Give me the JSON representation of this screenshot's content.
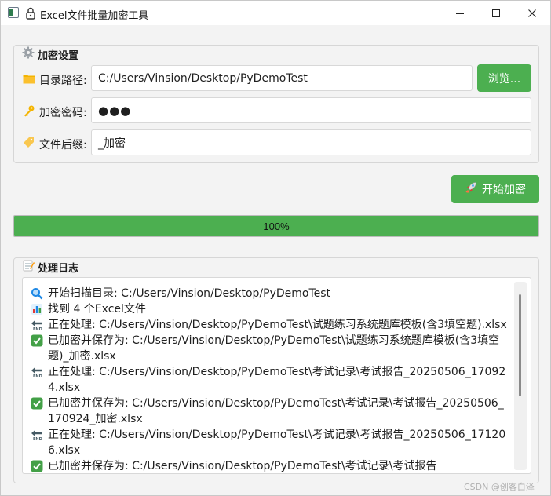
{
  "window": {
    "title": "Excel文件批量加密工具"
  },
  "settings": {
    "title": "加密设置",
    "dir_label": "目录路径:",
    "dir_value": "C:/Users/Vinsion/Desktop/PyDemoTest",
    "browse_label": "浏览...",
    "password_label": "加密密码:",
    "password_value": "●●●",
    "suffix_label": "文件后缀:",
    "suffix_value": "_加密"
  },
  "start_button": {
    "label": "开始加密"
  },
  "progress": {
    "value": 100,
    "text": "100%"
  },
  "log": {
    "title": "处理日志",
    "lines": [
      {
        "icon": "magnifier-icon",
        "text": "开始扫描目录: C:/Users/Vinsion/Desktop/PyDemoTest"
      },
      {
        "icon": "bar-chart-icon",
        "text": "找到 4 个Excel文件"
      },
      {
        "icon": "end-arrow-icon",
        "text": "正在处理: C:/Users/Vinsion/Desktop/PyDemoTest\\试题练习系统题库模板(含3填空题).xlsx"
      },
      {
        "icon": "check-icon",
        "text": "已加密并保存为: C:/Users/Vinsion/Desktop/PyDemoTest\\试题练习系统题库模板(含3填空题)_加密.xlsx"
      },
      {
        "icon": "end-arrow-icon",
        "text": "正在处理: C:/Users/Vinsion/Desktop/PyDemoTest\\考试记录\\考试报告_20250506_170924.xlsx"
      },
      {
        "icon": "check-icon",
        "text": "已加密并保存为: C:/Users/Vinsion/Desktop/PyDemoTest\\考试记录\\考试报告_20250506_170924_加密.xlsx"
      },
      {
        "icon": "end-arrow-icon",
        "text": "正在处理: C:/Users/Vinsion/Desktop/PyDemoTest\\考试记录\\考试报告_20250506_171206.xlsx"
      },
      {
        "icon": "check-icon",
        "text": "已加密并保存为: C:/Users/Vinsion/Desktop/PyDemoTest\\考试记录\\考试报告"
      }
    ]
  },
  "watermark": "CSDN @创客白泽",
  "colors": {
    "accent": "#4caf50",
    "background": "#f3f3f3"
  }
}
